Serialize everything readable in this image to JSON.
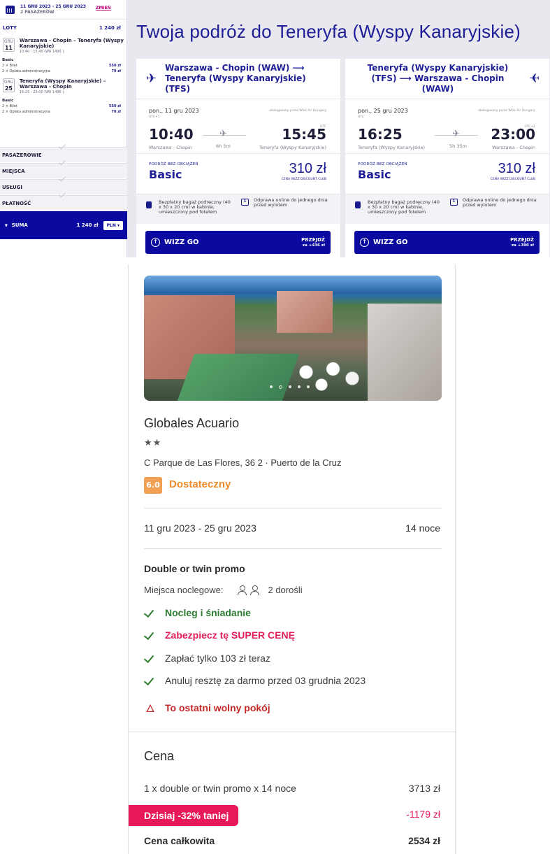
{
  "sidebar": {
    "dates": "11 GRU 2023 - 25 GRU 2023",
    "passengers": "2 PASAŻERÓW",
    "change_label": "ZMIEŃ",
    "loty_label": "LOTY",
    "loty_total": "1 240 zł",
    "flights": [
      {
        "month": "GRU",
        "day": "11",
        "route": "Warszawa - Chopin – Teneryfa (Wyspy Kanaryjskie)",
        "time": "10:40 - 15:45 (W6 1495 )",
        "fare": "Basic",
        "ticket_label": "2 × Bilet",
        "ticket_price": "550 zł",
        "fee_label": "2 × Opłata administracyjna",
        "fee_price": "70 zł"
      },
      {
        "month": "GRU",
        "day": "25",
        "route": "Teneryfa (Wyspy Kanaryjskie) – Warszawa - Chopin",
        "time": "16:25 - 23:00 (W6 1496 )",
        "fare": "Basic",
        "ticket_label": "2 × Bilet",
        "ticket_price": "550 zł",
        "fee_label": "2 × Opłata administracyjna",
        "fee_price": "70 zł"
      }
    ],
    "sections": [
      "PASAŻEROWIE",
      "MIEJSCA",
      "USŁUGI",
      "PŁATNOŚĆ"
    ],
    "suma_label": "SUMA",
    "suma_total": "1 240 zł",
    "currency": "PLN"
  },
  "trip_title": "Twoja podróż do Teneryfa (Wyspy Kanaryjskie)",
  "cards": [
    {
      "route": "Warszawa - Chopin (WAW) ⟶ Teneryfa (Wyspy Kanaryjskie) (TFS)",
      "date": "pon., 11 gru 2023",
      "operator": "obsługiwany przez Wizz Air Hungary",
      "utc_dep": "UTC+1",
      "utc_arr": "UTC",
      "dep_time": "10:40",
      "arr_time": "15:45",
      "duration": "6h 5m",
      "from": "Warszawa - Chopin",
      "to": "Teneryfa (Wyspy Kanaryjskie)",
      "fare_tag": "PODRÓŻ BEZ OBCIĄŻEŃ",
      "fare_name": "Basic",
      "price": "310 zł",
      "club": "CENA WIZZ DISCOUNT CLUB",
      "bag_info": "Bezpłatny bagaż podręczny (40 x 30 x 20 cm) w kabinie, umieszczony pod fotelem",
      "checkin_info": "Odprawa online do jednego dnia przed wylotem",
      "btn_label": "WIZZ GO",
      "btn_action": "PRZEJDŹ",
      "btn_extra": "za +436 zł"
    },
    {
      "route": "Teneryfa (Wyspy Kanaryjskie) (TFS) ⟶ Warszawa - Chopin (WAW)",
      "date": "pon., 25 gru 2023",
      "operator": "obsługiwany przez Wizz Air Hungary",
      "utc_dep": "UTC",
      "utc_arr": "UTC+1",
      "dep_time": "16:25",
      "arr_time": "23:00",
      "duration": "5h 35m",
      "from": "Teneryfa (Wyspy Kanaryjskie)",
      "to": "Warszawa - Chopin",
      "fare_tag": "PODRÓŻ BEZ OBCIĄŻEŃ",
      "fare_name": "Basic",
      "price": "310 zł",
      "club": "CENA WIZZ DISCOUNT CLUB",
      "bag_info": "Bezpłatny bagaż podręczny (40 x 30 x 20 cm) w kabinie, umieszczony pod fotelem",
      "checkin_info": "Odprawa online do jednego dnia przed wylotem",
      "btn_label": "WIZZ GO",
      "btn_action": "PRZEJDŹ",
      "btn_extra": "za +390 zł"
    }
  ],
  "hotel": {
    "name": "Globales Acuario",
    "stars": "★★",
    "address": "C Parque de Las Flores, 36 2 · Puerto de la Cruz",
    "score": "6.0",
    "score_label": "Dostateczny",
    "dates": "11 gru 2023 - 25 gru 2023",
    "nights": "14 noce",
    "room": "Double or twin promo",
    "beds_label": "Miejsca noclegowe:",
    "beds_value": "2 dorośli",
    "features": {
      "breakfast": "Nocleg i śniadanie",
      "super_price": "Zabezpiecz tę SUPER CENĘ",
      "pay_now": "Zapłać tylko 103 zł teraz",
      "cancel": "Anuluj resztę za darmo przed 03 grudnia 2023",
      "last_room": "To ostatni wolny pokój"
    },
    "price_title": "Cena",
    "price_line": "1 x double or twin promo x 14 noce",
    "price_line_value": "3713 zł",
    "promo_label": "Dzisiaj -32% taniej",
    "promo_value": "-1179 zł",
    "total_label": "Cena całkowita",
    "total_value": "2534 zł",
    "photo_index": 2,
    "photo_count": 5
  },
  "colors": {
    "wizz_navy": "#0a0aa0",
    "wizz_pink": "#c6007e",
    "score_orange": "#f2a154",
    "check_green": "#2e7d32",
    "promo_pink": "#e8195a"
  }
}
